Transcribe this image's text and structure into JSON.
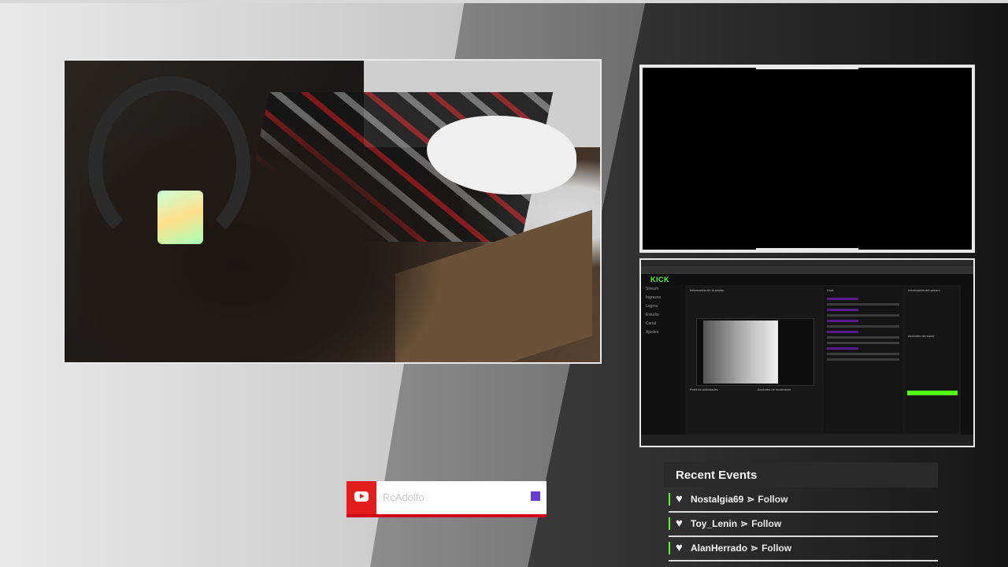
{
  "screen": {
    "brand": "KICK",
    "sidebar_items": [
      "Stream",
      "Ingresos",
      "Logros",
      "Estudio",
      "Canal",
      "Ajustes"
    ],
    "panels": [
      "Información de la sesión",
      "Chat",
      "Información del stream",
      "Feed de actividades",
      "Acciones de moderador",
      "Acciones del canal"
    ]
  },
  "subscribe_widget": {
    "platform_icon": "youtube-icon",
    "channel_name": "RcAdolfo",
    "accent_color": "#6a3dd1"
  },
  "recent_events": {
    "title": "Recent Events",
    "arrow": "⋗",
    "items": [
      {
        "user": "Nostalgia69",
        "action": "Follow"
      },
      {
        "user": "Toy_Lenin",
        "action": "Follow"
      },
      {
        "user": "AlanHerrado",
        "action": "Follow"
      }
    ]
  },
  "colors": {
    "kick_green": "#53fc18",
    "youtube_red": "#e31c1c",
    "frame_border": "#e8e8e8"
  }
}
